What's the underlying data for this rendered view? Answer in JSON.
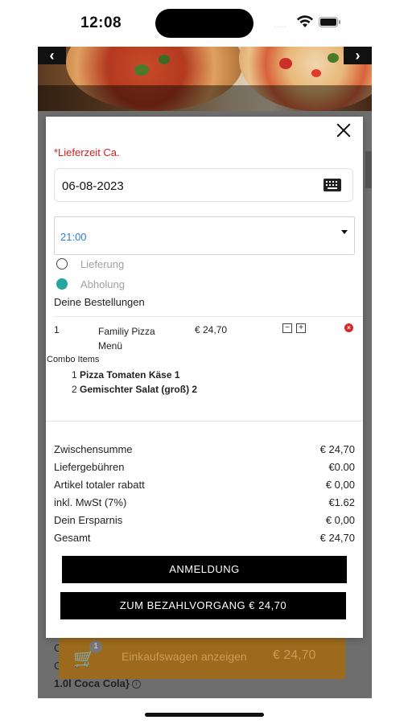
{
  "status_bar": {
    "time": "12:08",
    "signal": "····"
  },
  "background": {
    "prev_arrow": "‹",
    "next_arrow": "›",
    "cart_count": "1",
    "cart_label": "Einkaufswagen anzeigen",
    "cart_total": "€ 24,70",
    "letters": [
      "C",
      "C"
    ],
    "product_snippet": "1.0l Coca Cola}",
    "info_icon": "i"
  },
  "modal": {
    "delivery_label": "*Lieferzeit Ca.",
    "date_value": "06-08-2023",
    "time_value": "21:00",
    "options": [
      {
        "label": "Lieferung",
        "selected": false
      },
      {
        "label": "Abholung",
        "selected": true
      }
    ],
    "orders_heading": "Deine Bestellungen",
    "order": {
      "qty": "1",
      "name": "Familiy Pizza Menü",
      "price": "€ 24,70",
      "minus": "−",
      "plus": "+",
      "remove": "×"
    },
    "combo_heading": "Combo Items",
    "combo_items": [
      {
        "qty": "1",
        "name": "Pizza Tomaten Käse 1"
      },
      {
        "qty": "2",
        "name": "Gemischter Salat (groß) 2"
      }
    ],
    "totals": [
      {
        "label": "Zwischensumme",
        "value": "€ 24,70"
      },
      {
        "label": "Liefergebühren",
        "value": "€0.00"
      },
      {
        "label": "Artikel totaler rabatt",
        "value": "€ 0,00"
      },
      {
        "label": "inkl. MwSt (7%)",
        "value": "€1.62"
      },
      {
        "label": "Dein Ersparnis",
        "value": "€ 0,00"
      },
      {
        "label": "Gesamt",
        "value": "€ 24,70"
      }
    ],
    "login_button": "ANMELDUNG",
    "checkout_button": "ZUM BEZAHLVORGANG € 24,70"
  },
  "colors": {
    "accent_red": "#d31e1e",
    "teal": "#27a6a0",
    "link_blue": "#2a7fcf"
  }
}
